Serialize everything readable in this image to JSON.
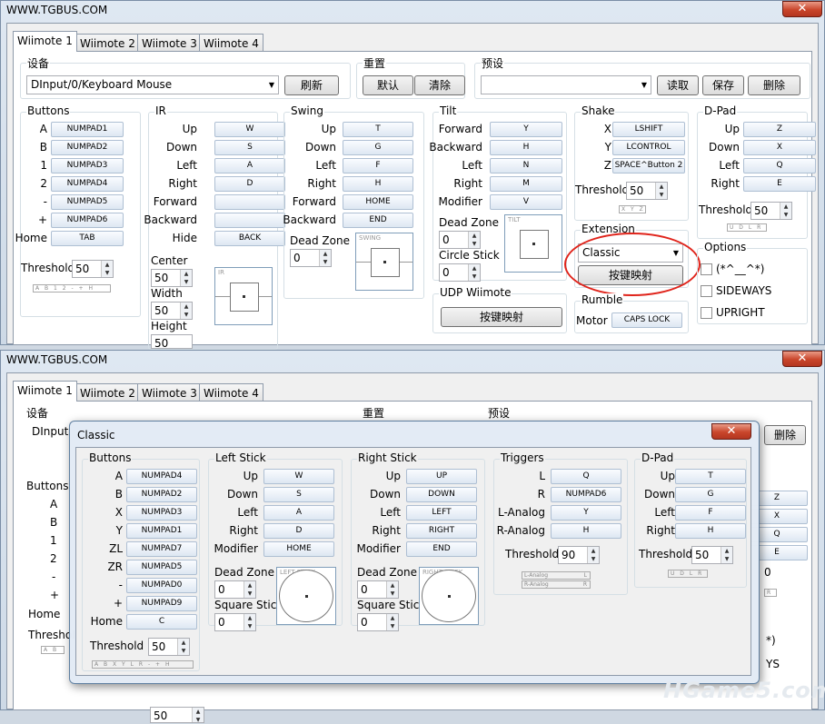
{
  "window": {
    "title": "WWW.TGBUS.COM"
  },
  "tabs": [
    "Wiimote 1",
    "Wiimote 2",
    "Wiimote 3",
    "Wiimote 4"
  ],
  "device": {
    "label": "设备",
    "value": "DInput/0/Keyboard Mouse",
    "value_partial": "DInput",
    "refresh": "刷新"
  },
  "reset": {
    "label": "重置",
    "default": "默认",
    "clear": "清除"
  },
  "preset": {
    "label": "预设",
    "value": "",
    "load": "读取",
    "save": "保存",
    "delete": "删除"
  },
  "buttons": {
    "label": "Buttons",
    "rows": [
      {
        "n": "A",
        "k": "NUMPAD1"
      },
      {
        "n": "B",
        "k": "NUMPAD2"
      },
      {
        "n": "1",
        "k": "NUMPAD3"
      },
      {
        "n": "2",
        "k": "NUMPAD4"
      },
      {
        "n": "-",
        "k": "NUMPAD5"
      },
      {
        "n": "+",
        "k": "NUMPAD6"
      },
      {
        "n": "Home",
        "k": "TAB"
      }
    ],
    "threshold_label": "Threshold",
    "threshold": "50",
    "strip": "A B 1 2 - + H"
  },
  "ir": {
    "label": "IR",
    "rows": [
      {
        "n": "Up",
        "k": "W"
      },
      {
        "n": "Down",
        "k": "S"
      },
      {
        "n": "Left",
        "k": "A"
      },
      {
        "n": "Right",
        "k": "D"
      },
      {
        "n": "Forward",
        "k": ""
      },
      {
        "n": "Backward",
        "k": ""
      },
      {
        "n": "Hide",
        "k": "BACK"
      }
    ],
    "center_label": "Center",
    "center": "50",
    "width_label": "Width",
    "width": "50",
    "height_label": "Height",
    "height": "50",
    "box": "IR"
  },
  "swing": {
    "label": "Swing",
    "rows": [
      {
        "n": "Up",
        "k": "T"
      },
      {
        "n": "Down",
        "k": "G"
      },
      {
        "n": "Left",
        "k": "F"
      },
      {
        "n": "Right",
        "k": "H"
      },
      {
        "n": "Forward",
        "k": "HOME"
      },
      {
        "n": "Backward",
        "k": "END"
      }
    ],
    "deadzone_label": "Dead Zone",
    "deadzone": "0",
    "box": "SWING"
  },
  "tilt": {
    "label": "Tilt",
    "rows": [
      {
        "n": "Forward",
        "k": "Y"
      },
      {
        "n": "Backward",
        "k": "H"
      },
      {
        "n": "Left",
        "k": "N"
      },
      {
        "n": "Right",
        "k": "M"
      },
      {
        "n": "Modifier",
        "k": "V"
      }
    ],
    "deadzone_label": "Dead Zone",
    "deadzone": "0",
    "circle_label": "Circle Stick",
    "circle": "0",
    "box": "TILT"
  },
  "shake": {
    "label": "Shake",
    "rows": [
      {
        "n": "X",
        "k": "LSHIFT"
      },
      {
        "n": "Y",
        "k": "LCONTROL"
      },
      {
        "n": "Z",
        "k": "SPACE^Button 2"
      }
    ],
    "threshold_label": "Threshold",
    "threshold": "50",
    "strip": "X Y Z"
  },
  "dpad": {
    "label": "D-Pad",
    "rows": [
      {
        "n": "Up",
        "k": "Z"
      },
      {
        "n": "Down",
        "k": "X"
      },
      {
        "n": "Left",
        "k": "Q"
      },
      {
        "n": "Right",
        "k": "E"
      }
    ],
    "threshold_label": "Threshold",
    "threshold": "50",
    "strip": "U D L R"
  },
  "extension": {
    "label": "Extension",
    "value": "Classic",
    "configure": "按键映射"
  },
  "options": {
    "label": "Options",
    "items": [
      "(*^__^*)",
      "SIDEWAYS",
      "UPRIGHT"
    ]
  },
  "udp": {
    "label": "UDP Wiimote",
    "configure": "按键映射"
  },
  "rumble": {
    "label": "Rumble",
    "motor_label": "Motor",
    "motor": "CAPS LOCK"
  },
  "bg_values": {
    "delete": "删除",
    "d_keys": [
      "Z",
      "X",
      "Q",
      "E"
    ],
    "thr": "0",
    "strip": "R",
    "opt_a": "*)",
    "opt_b": "YS",
    "height": "50",
    "btn_letters": [
      "A",
      "B",
      "1",
      "2",
      "-",
      "+"
    ],
    "home": "Home",
    "threshold": "Threshol",
    "strip_left": "A B"
  },
  "classic": {
    "title": "Classic",
    "buttons": {
      "label": "Buttons",
      "rows": [
        {
          "n": "A",
          "k": "NUMPAD4"
        },
        {
          "n": "B",
          "k": "NUMPAD2"
        },
        {
          "n": "X",
          "k": "NUMPAD3"
        },
        {
          "n": "Y",
          "k": "NUMPAD1"
        },
        {
          "n": "ZL",
          "k": "NUMPAD7"
        },
        {
          "n": "ZR",
          "k": "NUMPAD5"
        },
        {
          "n": "-",
          "k": "NUMPAD0"
        },
        {
          "n": "+",
          "k": "NUMPAD9"
        },
        {
          "n": "Home",
          "k": "C"
        }
      ],
      "threshold_label": "Threshold",
      "threshold": "50",
      "strip": "A B X Y L R - + H"
    },
    "lstick": {
      "label": "Left Stick",
      "rows": [
        {
          "n": "Up",
          "k": "W"
        },
        {
          "n": "Down",
          "k": "S"
        },
        {
          "n": "Left",
          "k": "A"
        },
        {
          "n": "Right",
          "k": "D"
        },
        {
          "n": "Modifier",
          "k": "HOME"
        }
      ],
      "deadzone_label": "Dead Zone",
      "deadzone": "0",
      "square_label": "Square Stick",
      "square": "0",
      "box": "LEFT STICK"
    },
    "rstick": {
      "label": "Right Stick",
      "rows": [
        {
          "n": "Up",
          "k": "UP"
        },
        {
          "n": "Down",
          "k": "DOWN"
        },
        {
          "n": "Left",
          "k": "LEFT"
        },
        {
          "n": "Right",
          "k": "RIGHT"
        },
        {
          "n": "Modifier",
          "k": "END"
        }
      ],
      "deadzone_label": "Dead Zone",
      "deadzone": "0",
      "square_label": "Square Stick",
      "square": "0",
      "box": "RIGHT STICK"
    },
    "triggers": {
      "label": "Triggers",
      "rows": [
        {
          "n": "L",
          "k": "Q"
        },
        {
          "n": "R",
          "k": "NUMPAD6"
        },
        {
          "n": "L-Analog",
          "k": "Y"
        },
        {
          "n": "R-Analog",
          "k": "H"
        }
      ],
      "threshold_label": "Threshold",
      "threshold": "90",
      "bar1": "L-Analog",
      "bar1b": "L",
      "bar2": "R-Analog",
      "bar2b": "R"
    },
    "dpad": {
      "label": "D-Pad",
      "rows": [
        {
          "n": "Up",
          "k": "T"
        },
        {
          "n": "Down",
          "k": "G"
        },
        {
          "n": "Left",
          "k": "F"
        },
        {
          "n": "Right",
          "k": "H"
        }
      ],
      "threshold_label": "Threshold",
      "threshold": "50",
      "strip": "U D L R"
    }
  },
  "watermark": "HGame5.com",
  "colors": {
    "highlight": "#e0241b",
    "close": "#c9452b"
  }
}
